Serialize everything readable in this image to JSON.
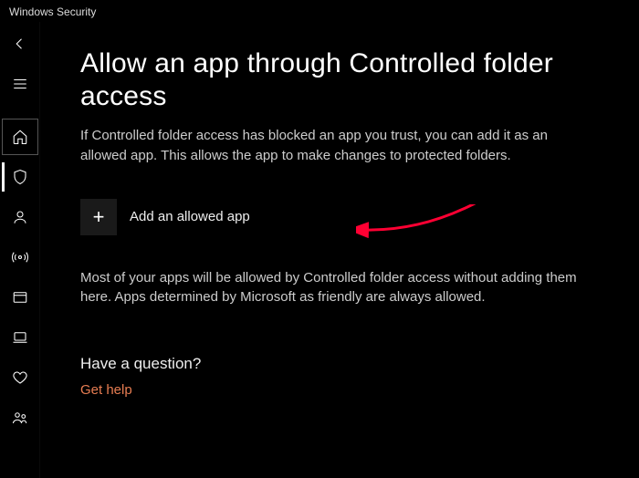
{
  "window": {
    "title": "Windows Security"
  },
  "sidebar": {
    "items": [
      {
        "name": "back",
        "icon": "back"
      },
      {
        "name": "menu",
        "icon": "menu"
      },
      {
        "name": "home",
        "icon": "home"
      },
      {
        "name": "virus-threat",
        "icon": "shield"
      },
      {
        "name": "account",
        "icon": "person"
      },
      {
        "name": "firewall",
        "icon": "network"
      },
      {
        "name": "app-browser",
        "icon": "window"
      },
      {
        "name": "device-security",
        "icon": "laptop"
      },
      {
        "name": "device-performance",
        "icon": "heart"
      },
      {
        "name": "family",
        "icon": "people"
      }
    ]
  },
  "page": {
    "title": "Allow an app through Controlled folder access",
    "description": "If Controlled folder access has blocked an app you trust, you can add it as an allowed app. This allows the app to make changes to protected folders.",
    "add_button_label": "Add an allowed app",
    "note": "Most of your apps will be allowed by Controlled folder access without adding them here. Apps determined by Microsoft as friendly are always allowed.",
    "question_heading": "Have a question?",
    "help_link": "Get help"
  },
  "annotation": {
    "arrow_color": "#ff0033"
  }
}
